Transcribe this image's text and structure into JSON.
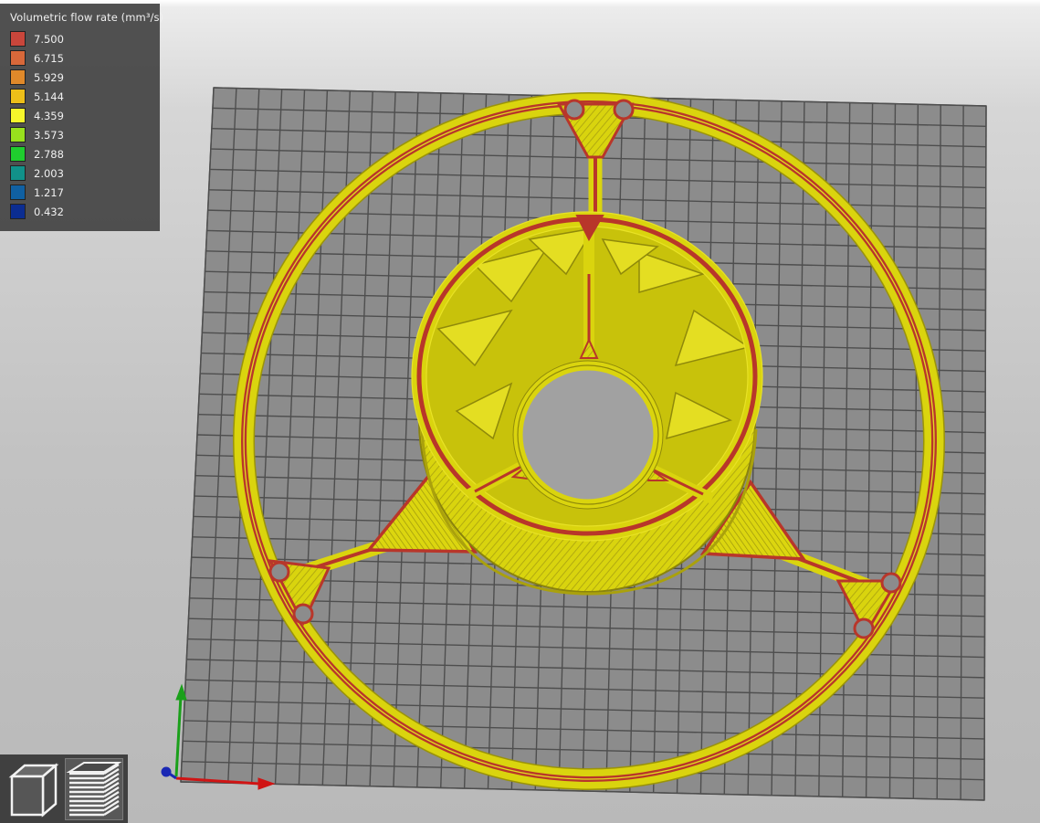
{
  "legend": {
    "title": "Volumetric flow rate (mm³/s)",
    "items": [
      {
        "value": "7.500",
        "color": "#c9463b"
      },
      {
        "value": "6.715",
        "color": "#d8683a"
      },
      {
        "value": "5.929",
        "color": "#e0892a"
      },
      {
        "value": "5.144",
        "color": "#edbf19"
      },
      {
        "value": "4.359",
        "color": "#f6f62b"
      },
      {
        "value": "3.573",
        "color": "#98e01d"
      },
      {
        "value": "2.788",
        "color": "#1fcd2e"
      },
      {
        "value": "2.003",
        "color": "#119189"
      },
      {
        "value": "1.217",
        "color": "#1060a2"
      },
      {
        "value": "0.432",
        "color": "#0b2d91"
      }
    ]
  },
  "viewport": {
    "bed_color": "#8c8c8c",
    "grid_line_color": "#4e4e4e",
    "print_color_main": "#d6d20c",
    "print_color_perimeter": "#b8362a",
    "axes": {
      "x_color": "#d01414",
      "y_color": "#1aa01a",
      "z_color": "#1a28b4"
    }
  },
  "view_buttons": [
    {
      "name": "3d-view",
      "icon": "cube-icon"
    },
    {
      "name": "layers-view",
      "icon": "layers-stack-icon",
      "active": true
    }
  ]
}
